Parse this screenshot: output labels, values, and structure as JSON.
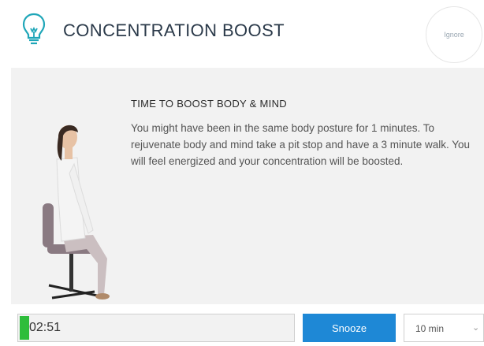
{
  "header": {
    "title": "CONCENTRATION BOOST",
    "ignore_label": "Ignore",
    "icon": "lightbulb-icon",
    "accent_color": "#1fa6b8"
  },
  "message": {
    "title": "TIME TO BOOST BODY & MIND",
    "body": "You might have been in the same body posture for 1 minutes. To rejuvenate body and mind take a pit stop and have a 3 minute walk. You will feel energized and your concentration will be boosted."
  },
  "footer": {
    "timer_text": "02:51",
    "timer_progress_color": "#2ebd3b",
    "snooze_label": "Snooze",
    "snooze_color": "#1e88d6",
    "snooze_duration": "10 min"
  }
}
